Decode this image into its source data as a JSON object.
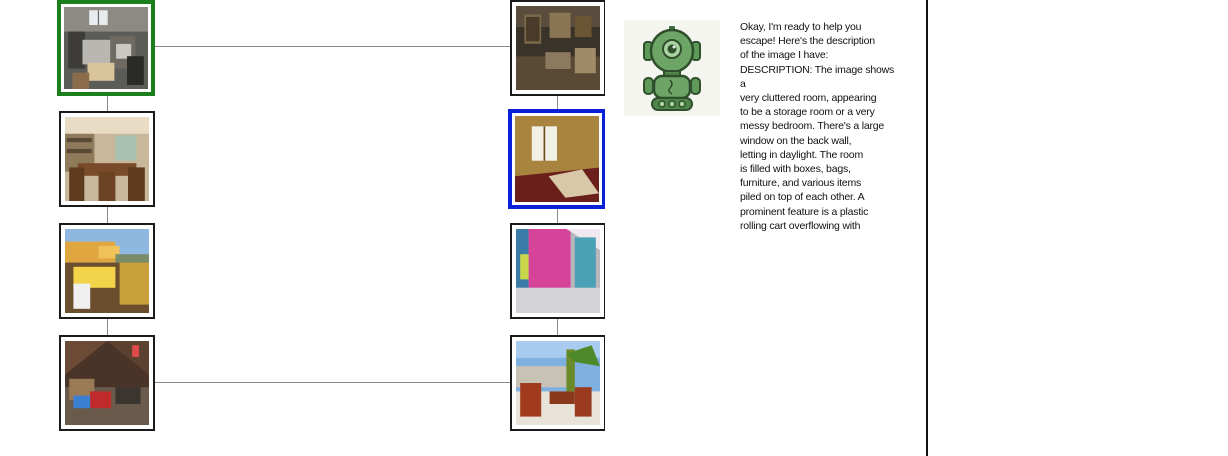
{
  "graph": {
    "nodes": [
      {
        "id": "cluttered-storage-room",
        "column": 0,
        "row": 0,
        "state": "start"
      },
      {
        "id": "dining-room",
        "column": 0,
        "row": 1,
        "state": "normal"
      },
      {
        "id": "balcony-terrace",
        "column": 0,
        "row": 2,
        "state": "normal"
      },
      {
        "id": "attic",
        "column": 0,
        "row": 3,
        "state": "normal"
      },
      {
        "id": "dark-paneled-room",
        "column": 1,
        "row": 0,
        "state": "normal"
      },
      {
        "id": "empty-room-window",
        "column": 1,
        "row": 1,
        "state": "current"
      },
      {
        "id": "pink-wall-room",
        "column": 1,
        "row": 2,
        "state": "normal"
      },
      {
        "id": "terrace-palm",
        "column": 1,
        "row": 3,
        "state": "normal"
      }
    ]
  },
  "colors": {
    "start_border": "#1b7f1b",
    "current_border": "#0a1fd8",
    "connector": "#8a8a8a",
    "robot_green": "#5f9a5a"
  },
  "assistant": {
    "avatar_icon": "robot-icon",
    "message": "Okay, I'm ready to help you\nescape! Here's the description\nof the image I have:\nDESCRIPTION: The image shows a\nvery cluttered room, appearing\nto be a storage room or a very\nmessy bedroom. There's a large\nwindow on the back wall,\nletting in daylight. The room\nis filled with boxes, bags,\nfurniture, and various items\npiled on top of each other. A\nprominent feature is a plastic\nrolling cart overflowing with\nitems. There's a chair with a"
  }
}
